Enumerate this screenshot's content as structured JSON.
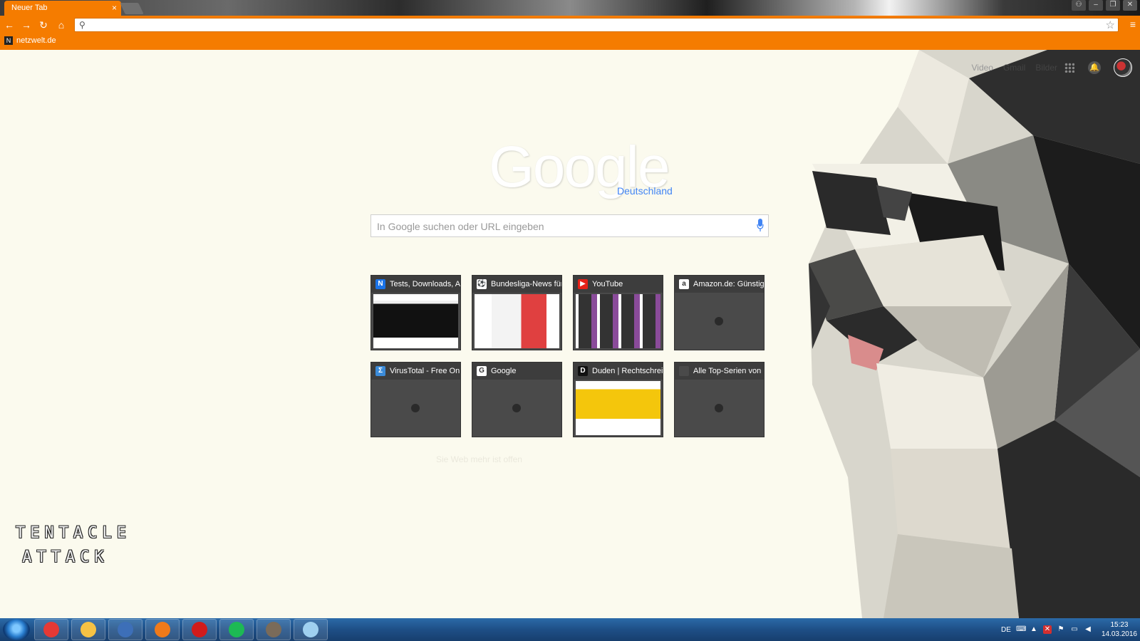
{
  "browser": {
    "tab_title": "Neuer Tab",
    "tab_close": "×",
    "omnibox_value": "",
    "bookmarks": [
      {
        "label": "netzwelt.de"
      }
    ],
    "accent_color": "#f57c00"
  },
  "ntp": {
    "top_links": [
      "Video",
      "Gmail",
      "Bilder"
    ],
    "logo_text": "Google",
    "logo_sub": "Deutschland",
    "search_placeholder": "In Google suchen oder URL eingeben",
    "tiles": [
      {
        "title": "Tests, Downloads, An",
        "favicon": "netzwelt-icon",
        "fav_char": "N",
        "fav_bg": "#1a73e8",
        "thumb": "netzwelt"
      },
      {
        "title": "Bundesliga-News für",
        "favicon": "soccer-ball-icon",
        "fav_char": "⚽",
        "fav_bg": "#ffffff",
        "thumb": "bundesliga"
      },
      {
        "title": "YouTube",
        "favicon": "youtube-icon",
        "fav_char": "▶",
        "fav_bg": "#e62117",
        "thumb": "youtube"
      },
      {
        "title": "Amazon.de: Günstige",
        "favicon": "amazon-icon",
        "fav_char": "a",
        "fav_bg": "#ffffff",
        "thumb": "empty"
      },
      {
        "title": "VirusTotal - Free Onli",
        "favicon": "virustotal-icon",
        "fav_char": "Σ",
        "fav_bg": "#3b8bd9",
        "thumb": "empty"
      },
      {
        "title": "Google",
        "favicon": "google-icon",
        "fav_char": "G",
        "fav_bg": "#ffffff",
        "thumb": "empty"
      },
      {
        "title": "Duden | Rechtschreib",
        "favicon": "duden-icon",
        "fav_char": "D",
        "fav_bg": "#111111",
        "thumb": "duden"
      },
      {
        "title": "Alle Top-Serien von N",
        "favicon": "page-icon",
        "fav_char": "",
        "fav_bg": "#4a4a4a",
        "thumb": "empty"
      }
    ],
    "bottom_hint": "Sie Web mehr ist offen"
  },
  "overlay_text": {
    "line1": "TENTACLE",
    "line2": "ATTACK"
  },
  "taskbar": {
    "apps": [
      {
        "name": "chrome-icon",
        "color": "#e53935"
      },
      {
        "name": "file-explorer-icon",
        "color": "#f6c244"
      },
      {
        "name": "thunderbird-icon",
        "color": "#3d6fb8"
      },
      {
        "name": "firefox-icon",
        "color": "#f07a1a"
      },
      {
        "name": "opera-icon",
        "color": "#d11b1b"
      },
      {
        "name": "spotify-icon",
        "color": "#1db954"
      },
      {
        "name": "gimp-icon",
        "color": "#7a6b5a"
      },
      {
        "name": "notepad-icon",
        "color": "#9fd0f0"
      }
    ],
    "lang": "DE",
    "time": "15:23",
    "date": "14.03.2016"
  }
}
